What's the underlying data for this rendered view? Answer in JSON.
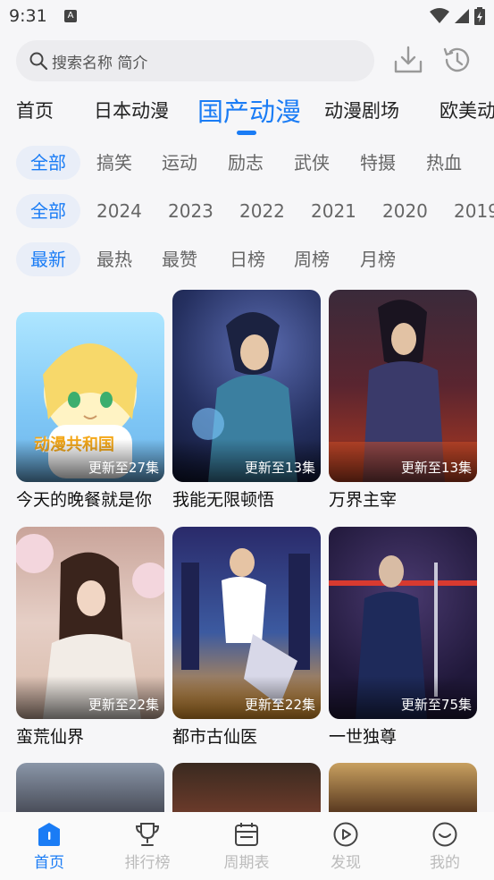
{
  "status_bar": {
    "time": "9:31",
    "notification_letter": "A"
  },
  "search": {
    "placeholder": "搜索名称 简介"
  },
  "main_tabs": [
    {
      "label": "首页",
      "active": false
    },
    {
      "label": "日本动漫",
      "active": false
    },
    {
      "label": "国产动漫",
      "active": true
    },
    {
      "label": "动漫剧场",
      "active": false
    },
    {
      "label": "欧美动",
      "active": false
    }
  ],
  "genre_filters": [
    "全部",
    "搞笑",
    "运动",
    "励志",
    "武侠",
    "特摄",
    "热血"
  ],
  "year_filters": [
    "全部",
    "2024",
    "2023",
    "2022",
    "2021",
    "2020",
    "2019"
  ],
  "sort_filters": [
    "最新",
    "最热",
    "最赞",
    "日榜",
    "周榜",
    "月榜"
  ],
  "cards": [
    {
      "title": "今天的晚餐就是你",
      "episodes": "更新至27集",
      "logo": "动漫共和国"
    },
    {
      "title": "我能无限顿悟",
      "episodes": "更新至13集"
    },
    {
      "title": "万界主宰",
      "episodes": "更新至13集"
    },
    {
      "title": "蛮荒仙界",
      "episodes": "更新至22集"
    },
    {
      "title": "都市古仙医",
      "episodes": "更新至22集"
    },
    {
      "title": "一世独尊",
      "episodes": "更新至75集"
    }
  ],
  "bottom_nav": [
    {
      "label": "首页",
      "icon": "home-icon",
      "active": true
    },
    {
      "label": "排行榜",
      "icon": "trophy-icon",
      "active": false
    },
    {
      "label": "周期表",
      "icon": "calendar-icon",
      "active": false
    },
    {
      "label": "发现",
      "icon": "play-circle-icon",
      "active": false
    },
    {
      "label": "我的",
      "icon": "smile-icon",
      "active": false
    }
  ],
  "colors": {
    "accent": "#1a7cf5",
    "chip_bg": "#e9eef8",
    "inactive_nav": "#bbbbbb"
  }
}
